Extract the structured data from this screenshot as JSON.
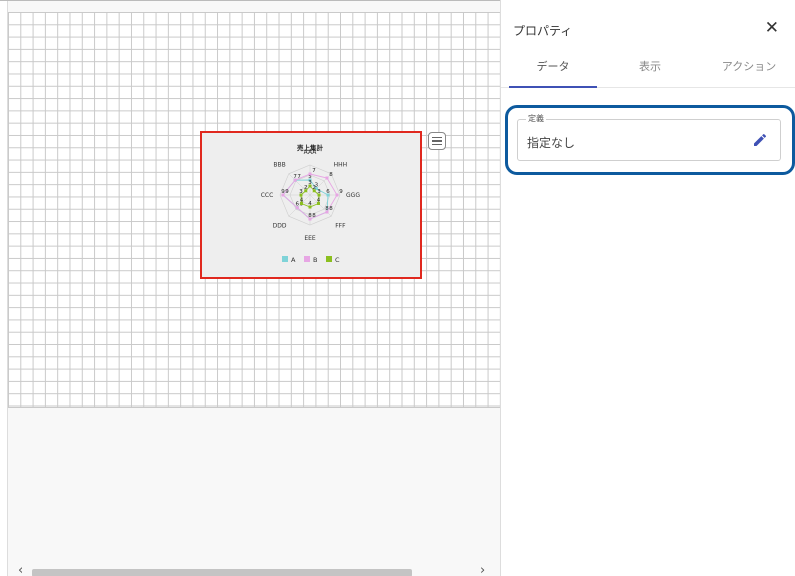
{
  "panel": {
    "title": "プロパティ",
    "close_icon": "close-icon",
    "tabs": [
      {
        "label": "データ",
        "active": true
      },
      {
        "label": "表示",
        "active": false
      },
      {
        "label": "アクション",
        "active": false
      }
    ],
    "definition": {
      "label": "定義",
      "value": "指定なし",
      "edit_icon": "pencil-icon"
    }
  },
  "colors": {
    "accent": "#3f51b5",
    "highlight_border": "#0d5a9e",
    "widget_border": "#e0281e",
    "series_a": "#7fd3d8",
    "series_b": "#e7a6e4",
    "series_c": "#8bbf1f"
  },
  "chart_data": {
    "type": "radar",
    "title": "売上集計",
    "categories": [
      "AAA",
      "HHH",
      "GGG",
      "FFF",
      "EEE",
      "DDD",
      "CCC",
      "BBB"
    ],
    "series": [
      {
        "name": "A",
        "values": [
          5,
          3,
          6,
          8,
          8,
          6,
          9,
          7
        ]
      },
      {
        "name": "B",
        "values": [
          7,
          8,
          9,
          8,
          8,
          6,
          9,
          7
        ]
      },
      {
        "name": "C",
        "values": [
          3,
          2,
          3,
          4,
          4,
          4,
          3,
          2
        ]
      }
    ],
    "rmax": 10,
    "legend_position": "bottom"
  }
}
